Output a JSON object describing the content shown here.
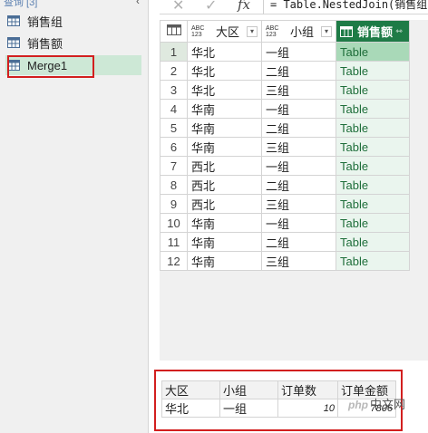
{
  "query_pane": {
    "header": "查询 [3]",
    "items": [
      {
        "label": "销售组",
        "icon": "table-icon"
      },
      {
        "label": "销售额",
        "icon": "table-icon"
      },
      {
        "label": "Merge1",
        "icon": "table-icon",
        "selected": true
      }
    ]
  },
  "formula_bar": {
    "cancel_icon": "✕",
    "accept_icon": "✓",
    "fx_label": "fx",
    "formula": "= Table.NestedJoin(销售组,{"
  },
  "grid": {
    "columns": [
      {
        "type": "ABC\n123",
        "name": "大区"
      },
      {
        "type": "ABC\n123",
        "name": "小组"
      },
      {
        "type": "table",
        "name": "销售额"
      }
    ],
    "rows": [
      {
        "n": "1",
        "region": "华北",
        "group": "一组",
        "sales": "Table"
      },
      {
        "n": "2",
        "region": "华北",
        "group": "二组",
        "sales": "Table"
      },
      {
        "n": "3",
        "region": "华北",
        "group": "三组",
        "sales": "Table"
      },
      {
        "n": "4",
        "region": "华南",
        "group": "一组",
        "sales": "Table"
      },
      {
        "n": "5",
        "region": "华南",
        "group": "二组",
        "sales": "Table"
      },
      {
        "n": "6",
        "region": "华南",
        "group": "三组",
        "sales": "Table"
      },
      {
        "n": "7",
        "region": "西北",
        "group": "一组",
        "sales": "Table"
      },
      {
        "n": "8",
        "region": "西北",
        "group": "二组",
        "sales": "Table"
      },
      {
        "n": "9",
        "region": "西北",
        "group": "三组",
        "sales": "Table"
      },
      {
        "n": "10",
        "region": "华南",
        "group": "一组",
        "sales": "Table"
      },
      {
        "n": "11",
        "region": "华南",
        "group": "二组",
        "sales": "Table"
      },
      {
        "n": "12",
        "region": "华南",
        "group": "三组",
        "sales": "Table"
      }
    ],
    "selected_row": 1
  },
  "preview": {
    "headers": [
      "大区",
      "小组",
      "订单数",
      "订单金额"
    ],
    "row": [
      "华北",
      "一组",
      "10",
      "7806"
    ]
  },
  "watermark": {
    "logo": "php",
    "text": "中文网"
  },
  "colors": {
    "accent": "#1e7b46",
    "highlight": "#a9d9b8",
    "annotation": "#d21f1f"
  }
}
